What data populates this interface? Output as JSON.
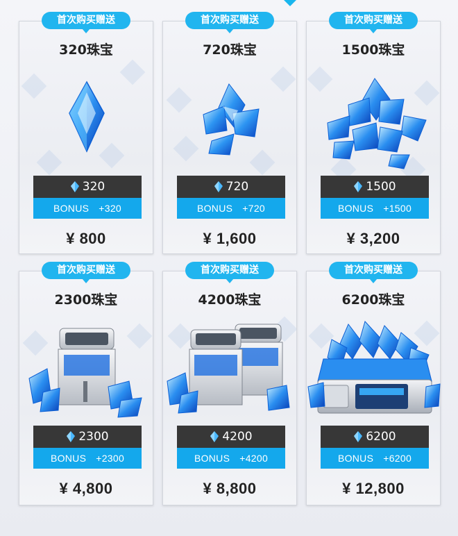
{
  "colors": {
    "accent": "#21b5ef",
    "bonus_bar": "#14a8ec",
    "amount_panel": "#373737",
    "card_bg": "#eef0f4"
  },
  "shop": {
    "items": [
      {
        "tag": "首次购买赠送",
        "title": "320珠宝",
        "amount": "320",
        "bonus_label": "BONUS",
        "bonus_value": "+320",
        "price": "¥ 800",
        "art": "single-crystal"
      },
      {
        "tag": "首次购买赠送",
        "title": "720珠宝",
        "amount": "720",
        "bonus_label": "BONUS",
        "bonus_value": "+720",
        "price": "¥ 1,600",
        "art": "crystal-cluster"
      },
      {
        "tag": "首次购买赠送",
        "title": "1500珠宝",
        "amount": "1500",
        "bonus_label": "BONUS",
        "bonus_value": "+1500",
        "price": "¥ 3,200",
        "art": "crystal-pile"
      },
      {
        "tag": "首次购买赠送",
        "title": "2300珠宝",
        "amount": "2300",
        "bonus_label": "BONUS",
        "bonus_value": "+2300",
        "price": "¥ 4,800",
        "art": "crystal-crate"
      },
      {
        "tag": "首次购买赠送",
        "title": "4200珠宝",
        "amount": "4200",
        "bonus_label": "BONUS",
        "bonus_value": "+4200",
        "price": "¥ 8,800",
        "art": "double-crystal-crate"
      },
      {
        "tag": "首次购买赠送",
        "title": "6200珠宝",
        "amount": "6200",
        "bonus_label": "BONUS",
        "bonus_value": "+6200",
        "price": "¥ 12,800",
        "art": "crystal-chest"
      }
    ]
  }
}
